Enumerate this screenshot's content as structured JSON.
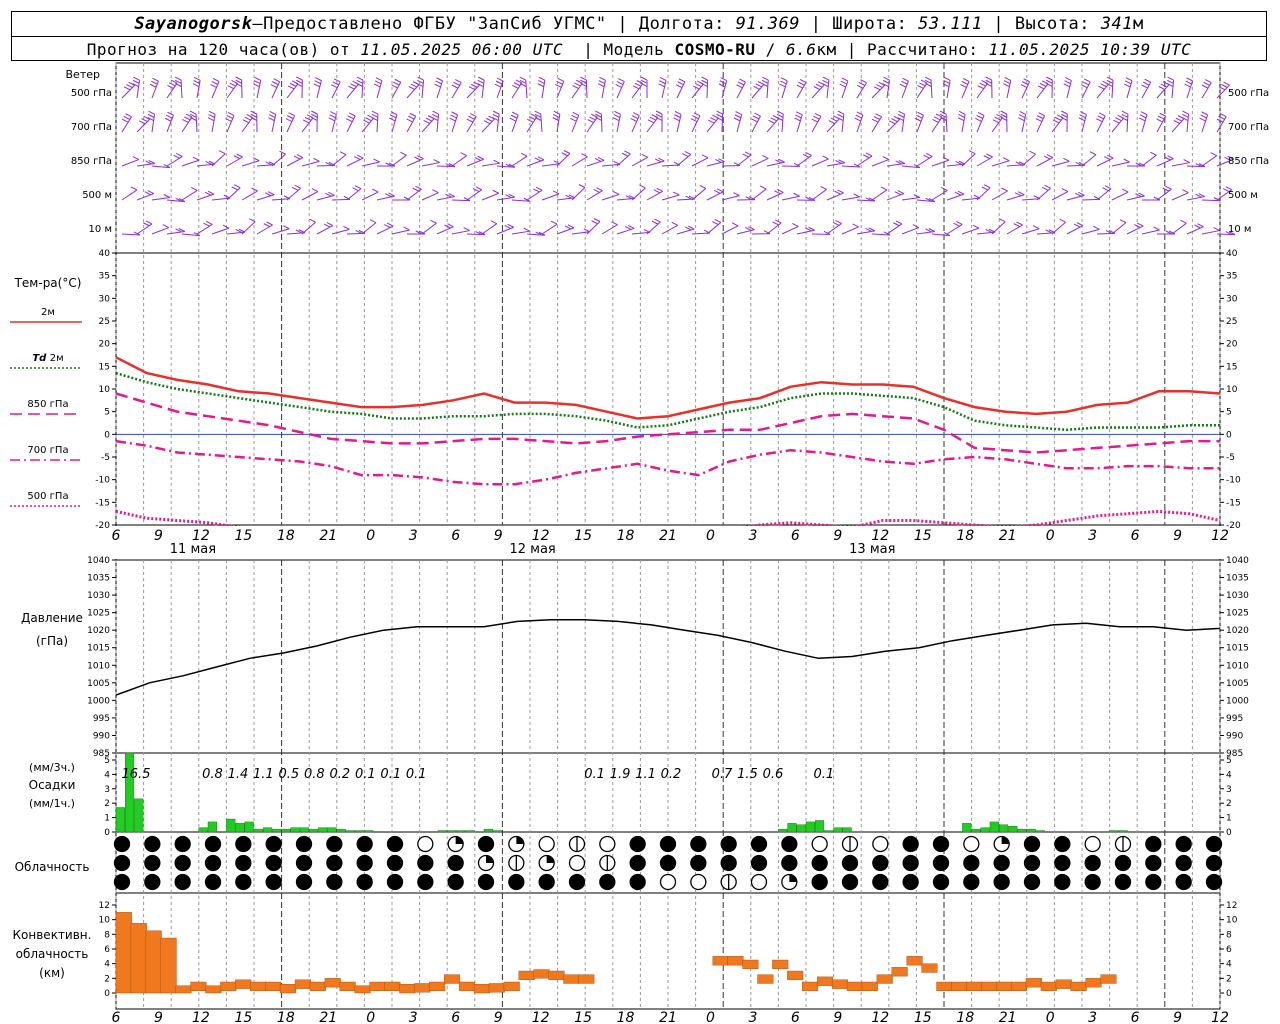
{
  "header": {
    "station": "Sayanogorsk",
    "dash": " — ",
    "provider": "Предоставлено ФГБУ \"ЗапСиб УГМС\"",
    "lon_label": "Долгота:",
    "lon_value": "91.369",
    "lat_label": "Широта:",
    "lat_value": "53.111",
    "alt_label": "Высота:",
    "alt_value": "341",
    "alt_unit": "м",
    "forecast_label": "Прогноз на 120 часа(ов) от",
    "forecast_start": "11.05.2025 06:00 UTC",
    "model_label": "Модель",
    "model_name": "COSMO-RU",
    "model_res": "6.6",
    "model_res_unit": "км",
    "calc_label": "Рассчитано:",
    "calc_time": "11.05.2025 10:39 UTC",
    "sep": "|"
  },
  "panels": {
    "wind": {
      "title": "Ветер",
      "levels": [
        "500 гПа",
        "700 гПа",
        "850 гПа",
        "500 м",
        "10  м"
      ],
      "color": "#8a2be2"
    },
    "temp": {
      "title": "Тем-ра(°C)",
      "legend": [
        {
          "label": "2м",
          "color": "#e8302a",
          "style": "solid"
        },
        {
          "label_it": "Td",
          "label": "2м",
          "color": "#137a13",
          "style": "dotted"
        },
        {
          "label": "850 гПа",
          "color": "#e6198a",
          "style": "dashed"
        },
        {
          "label": "700 гПа",
          "color": "#e6198a",
          "style": "dashdot"
        },
        {
          "label": "500 гПа",
          "color": "#e6198a",
          "style": "dotted"
        }
      ]
    },
    "pressure": {
      "title": "Давление",
      "unit": "(гПа)"
    },
    "precip": {
      "unit3": "(мм/3ч.)",
      "title": "Осадки",
      "unit1": "(мм/1ч.)",
      "color": "#22cc22"
    },
    "cloud": {
      "title": "Облачность"
    },
    "conv": {
      "title1": "Конвективн.",
      "title2": "облачность",
      "unit": "(км)",
      "color": "#f0781e"
    }
  },
  "axis": {
    "hour_labels": [
      "6",
      "9",
      "12",
      "15",
      "18",
      "21",
      "0",
      "3",
      "6",
      "9",
      "12",
      "15",
      "18",
      "21",
      "0",
      "3",
      "6",
      "9",
      "12",
      "15",
      "18",
      "21",
      "0",
      "3",
      "6",
      "9",
      "12"
    ],
    "date_labels": [
      "11 мая",
      "12 мая",
      "13 мая"
    ]
  },
  "chart_data": [
    {
      "type": "line",
      "title": "Тем-ра(°C)",
      "x_hours_from_start": [
        0,
        3,
        6,
        9,
        12,
        15,
        18,
        21,
        24,
        27,
        30,
        33,
        36,
        39,
        42,
        45,
        48,
        51,
        54,
        57,
        60,
        63,
        66,
        69,
        72,
        75,
        78,
        81,
        84,
        87,
        90,
        93,
        96,
        99,
        102,
        105,
        108,
        111,
        114,
        117,
        120
      ],
      "ylim": [
        -20,
        40
      ],
      "yticks": [
        -20,
        -15,
        -10,
        -5,
        0,
        5,
        10,
        15,
        20,
        25,
        30,
        35,
        40
      ],
      "series": [
        {
          "name": "2м",
          "values": [
            17,
            13.5,
            12,
            11,
            9.5,
            9,
            8,
            7,
            6,
            6,
            6.5,
            7.5,
            9,
            7,
            7,
            6.5,
            5,
            3.5,
            4,
            5.5,
            7,
            8,
            10.5,
            11.5,
            11,
            11,
            10.5,
            8,
            6,
            5,
            4.5,
            5,
            6.5,
            7,
            9.5,
            9.5,
            9
          ]
        },
        {
          "name": "Td 2м",
          "values": [
            13.5,
            11.5,
            10,
            9,
            8,
            7,
            6,
            5,
            4.5,
            3.5,
            3.5,
            4,
            4,
            4.5,
            4.5,
            4,
            3,
            1.5,
            2,
            3.5,
            5,
            6,
            8,
            9,
            9,
            8.5,
            8,
            6,
            3,
            2,
            1.5,
            1,
            1.5,
            1.5,
            1.5,
            2,
            2
          ]
        },
        {
          "name": "850 гПа",
          "values": [
            9,
            7,
            5,
            4,
            3,
            2,
            0.5,
            -1,
            -1.5,
            -2,
            -2,
            -1.5,
            -1,
            -1,
            -1.5,
            -2,
            -1.5,
            -0.5,
            0,
            0.5,
            1,
            1,
            2.5,
            4,
            4.5,
            4,
            3.5,
            1,
            -3,
            -3.5,
            -4,
            -3.5,
            -3,
            -2.5,
            -2,
            -1.5,
            -1.5
          ]
        },
        {
          "name": "700 гПа",
          "values": [
            -1.5,
            -2.5,
            -4,
            -4.5,
            -5,
            -5.5,
            -6,
            -7,
            -9,
            -9,
            -9.5,
            -10.5,
            -11,
            -11,
            -10,
            -8.5,
            -7.5,
            -6.5,
            -8,
            -9,
            -6,
            -4.5,
            -3.5,
            -4,
            -5,
            -6,
            -6.5,
            -5.5,
            -5,
            -5.5,
            -6.5,
            -7.5,
            -7.5,
            -7,
            -7,
            -7.5,
            -7.5
          ]
        },
        {
          "name": "500 гПа",
          "values": [
            -17,
            -18.5,
            -19,
            -19.5,
            -20.5,
            -21,
            -21.5,
            -22,
            -22,
            -22,
            -22,
            -22,
            -22,
            -22,
            -22,
            -22,
            -22,
            -22,
            -22,
            -22,
            -21,
            -20,
            -19.5,
            -20,
            -20.5,
            -19,
            -19,
            -19.5,
            -20,
            -20.5,
            -20,
            -19,
            -18,
            -17.5,
            -17,
            -17.5,
            -19
          ]
        }
      ]
    },
    {
      "type": "line",
      "title": "Давление",
      "ylabel": "(гПа)",
      "ylim": [
        985,
        1040
      ],
      "yticks": [
        985,
        990,
        995,
        1000,
        1005,
        1010,
        1015,
        1020,
        1025,
        1030,
        1035,
        1040
      ],
      "series": [
        {
          "name": "Давление",
          "values": [
            1001.5,
            1005,
            1007,
            1009.5,
            1012,
            1013.5,
            1015.5,
            1018,
            1020,
            1021,
            1021,
            1021,
            1022.5,
            1023,
            1023,
            1022.5,
            1021.5,
            1020,
            1018.5,
            1016.5,
            1014,
            1012,
            1012.5,
            1014,
            1015,
            1017,
            1018.5,
            1020,
            1021.5,
            1022,
            1021,
            1021,
            1020,
            1020.5
          ]
        }
      ]
    },
    {
      "type": "bar",
      "title": "Осадки",
      "ylim": [
        0,
        5
      ],
      "yticks": [
        0,
        1,
        2,
        3,
        4,
        5
      ],
      "values_3h": [
        {
          "hour": 0,
          "label": "16.5"
        },
        {
          "hour": 9,
          "label": "0.8"
        },
        {
          "hour": 12,
          "label": "1.4"
        },
        {
          "hour": 15,
          "label": "1.1"
        },
        {
          "hour": 18,
          "label": "0.5"
        },
        {
          "hour": 21,
          "label": "0.8"
        },
        {
          "hour": 24,
          "label": "0.2"
        },
        {
          "hour": 27,
          "label": "0.1"
        },
        {
          "hour": 30,
          "label": "0.1"
        },
        {
          "hour": 33,
          "label": "0.1"
        },
        {
          "hour": 54,
          "label": "0.1"
        },
        {
          "hour": 57,
          "label": "1.9"
        },
        {
          "hour": 60,
          "label": "1.1"
        },
        {
          "hour": 63,
          "label": "0.2"
        },
        {
          "hour": 69,
          "label": "0.7"
        },
        {
          "hour": 72,
          "label": "1.5"
        },
        {
          "hour": 75,
          "label": "0.6"
        },
        {
          "hour": 81,
          "label": "0.1"
        }
      ],
      "values_1h": [
        1.7,
        8.3,
        2.3,
        0,
        0,
        0,
        0,
        0,
        0,
        0.3,
        0.7,
        0,
        0.9,
        0.6,
        0.7,
        0.2,
        0.3,
        0.2,
        0.2,
        0.3,
        0.3,
        0.2,
        0.3,
        0.3,
        0.2,
        0.1,
        0.1,
        0.1,
        0,
        0,
        0,
        0,
        0,
        0,
        0,
        0.1,
        0.1,
        0.1,
        0.1,
        0,
        0.2,
        0.1,
        0,
        0,
        0,
        0,
        0,
        0,
        0,
        0,
        0,
        0,
        0,
        0,
        0,
        0,
        0,
        0,
        0,
        0,
        0,
        0,
        0,
        0,
        0,
        0,
        0,
        0,
        0,
        0,
        0,
        0,
        0.2,
        0.6,
        0.5,
        0.7,
        0.8,
        0.1,
        0.3,
        0.3,
        0,
        0,
        0,
        0,
        0,
        0,
        0,
        0,
        0,
        0,
        0,
        0,
        0.6,
        0.2,
        0.3,
        0.7,
        0.5,
        0.4,
        0.2,
        0.2,
        0.1,
        0,
        0,
        0,
        0,
        0,
        0,
        0,
        0.1,
        0.1,
        0,
        0,
        0,
        0,
        0,
        0,
        0,
        0,
        0,
        0,
        0,
        0,
        0
      ]
    },
    {
      "type": "bar",
      "title": "Конвективн. облачность",
      "ylabel": "(км)",
      "ylim": [
        0,
        13
      ],
      "yticks": [
        0,
        2,
        4,
        6,
        8,
        10,
        12
      ],
      "segments_km": [
        [
          0,
          11
        ],
        [
          1,
          9.5
        ],
        [
          2,
          8.5
        ],
        [
          3,
          7.5
        ],
        [
          4,
          1
        ],
        [
          5,
          1.5
        ],
        [
          6,
          1
        ],
        [
          7,
          1.5
        ],
        [
          8,
          1.8
        ],
        [
          9,
          1.5
        ],
        [
          10,
          1.5
        ],
        [
          11,
          1.2
        ],
        [
          12,
          1.8
        ],
        [
          13,
          1.5
        ],
        [
          14,
          2
        ],
        [
          15,
          1.5
        ],
        [
          16,
          1
        ],
        [
          17,
          1.5
        ],
        [
          18,
          1.5
        ],
        [
          19,
          1.2
        ],
        [
          20,
          1.3
        ],
        [
          21,
          1.5
        ],
        [
          22,
          2.5
        ],
        [
          23,
          1.5
        ],
        [
          24,
          1.2
        ],
        [
          25,
          1.3
        ],
        [
          26,
          1.5
        ],
        [
          27,
          3
        ],
        [
          28,
          3.2
        ],
        [
          29,
          3
        ],
        [
          30,
          2.5
        ],
        [
          31,
          2.5
        ],
        [
          40,
          5
        ],
        [
          41,
          5
        ],
        [
          42,
          4.5
        ],
        [
          43,
          2.5
        ],
        [
          44,
          4.5
        ],
        [
          45,
          3
        ],
        [
          46,
          1.5
        ],
        [
          47,
          2.2
        ],
        [
          48,
          1.8
        ],
        [
          49,
          1.5
        ],
        [
          50,
          1.5
        ],
        [
          51,
          2.5
        ],
        [
          52,
          3.5
        ],
        [
          53,
          5
        ],
        [
          54,
          4
        ],
        [
          55,
          1.5
        ],
        [
          56,
          1.5
        ],
        [
          57,
          1.5
        ],
        [
          58,
          1.5
        ],
        [
          59,
          1.5
        ],
        [
          60,
          1.5
        ],
        [
          61,
          2
        ],
        [
          62,
          1.5
        ],
        [
          63,
          1.8
        ],
        [
          64,
          1.5
        ],
        [
          65,
          2
        ],
        [
          66,
          2.5
        ]
      ]
    },
    {
      "type": "table",
      "title": "Облачность",
      "rows": 3,
      "symbols_per_row": 37
    }
  ]
}
